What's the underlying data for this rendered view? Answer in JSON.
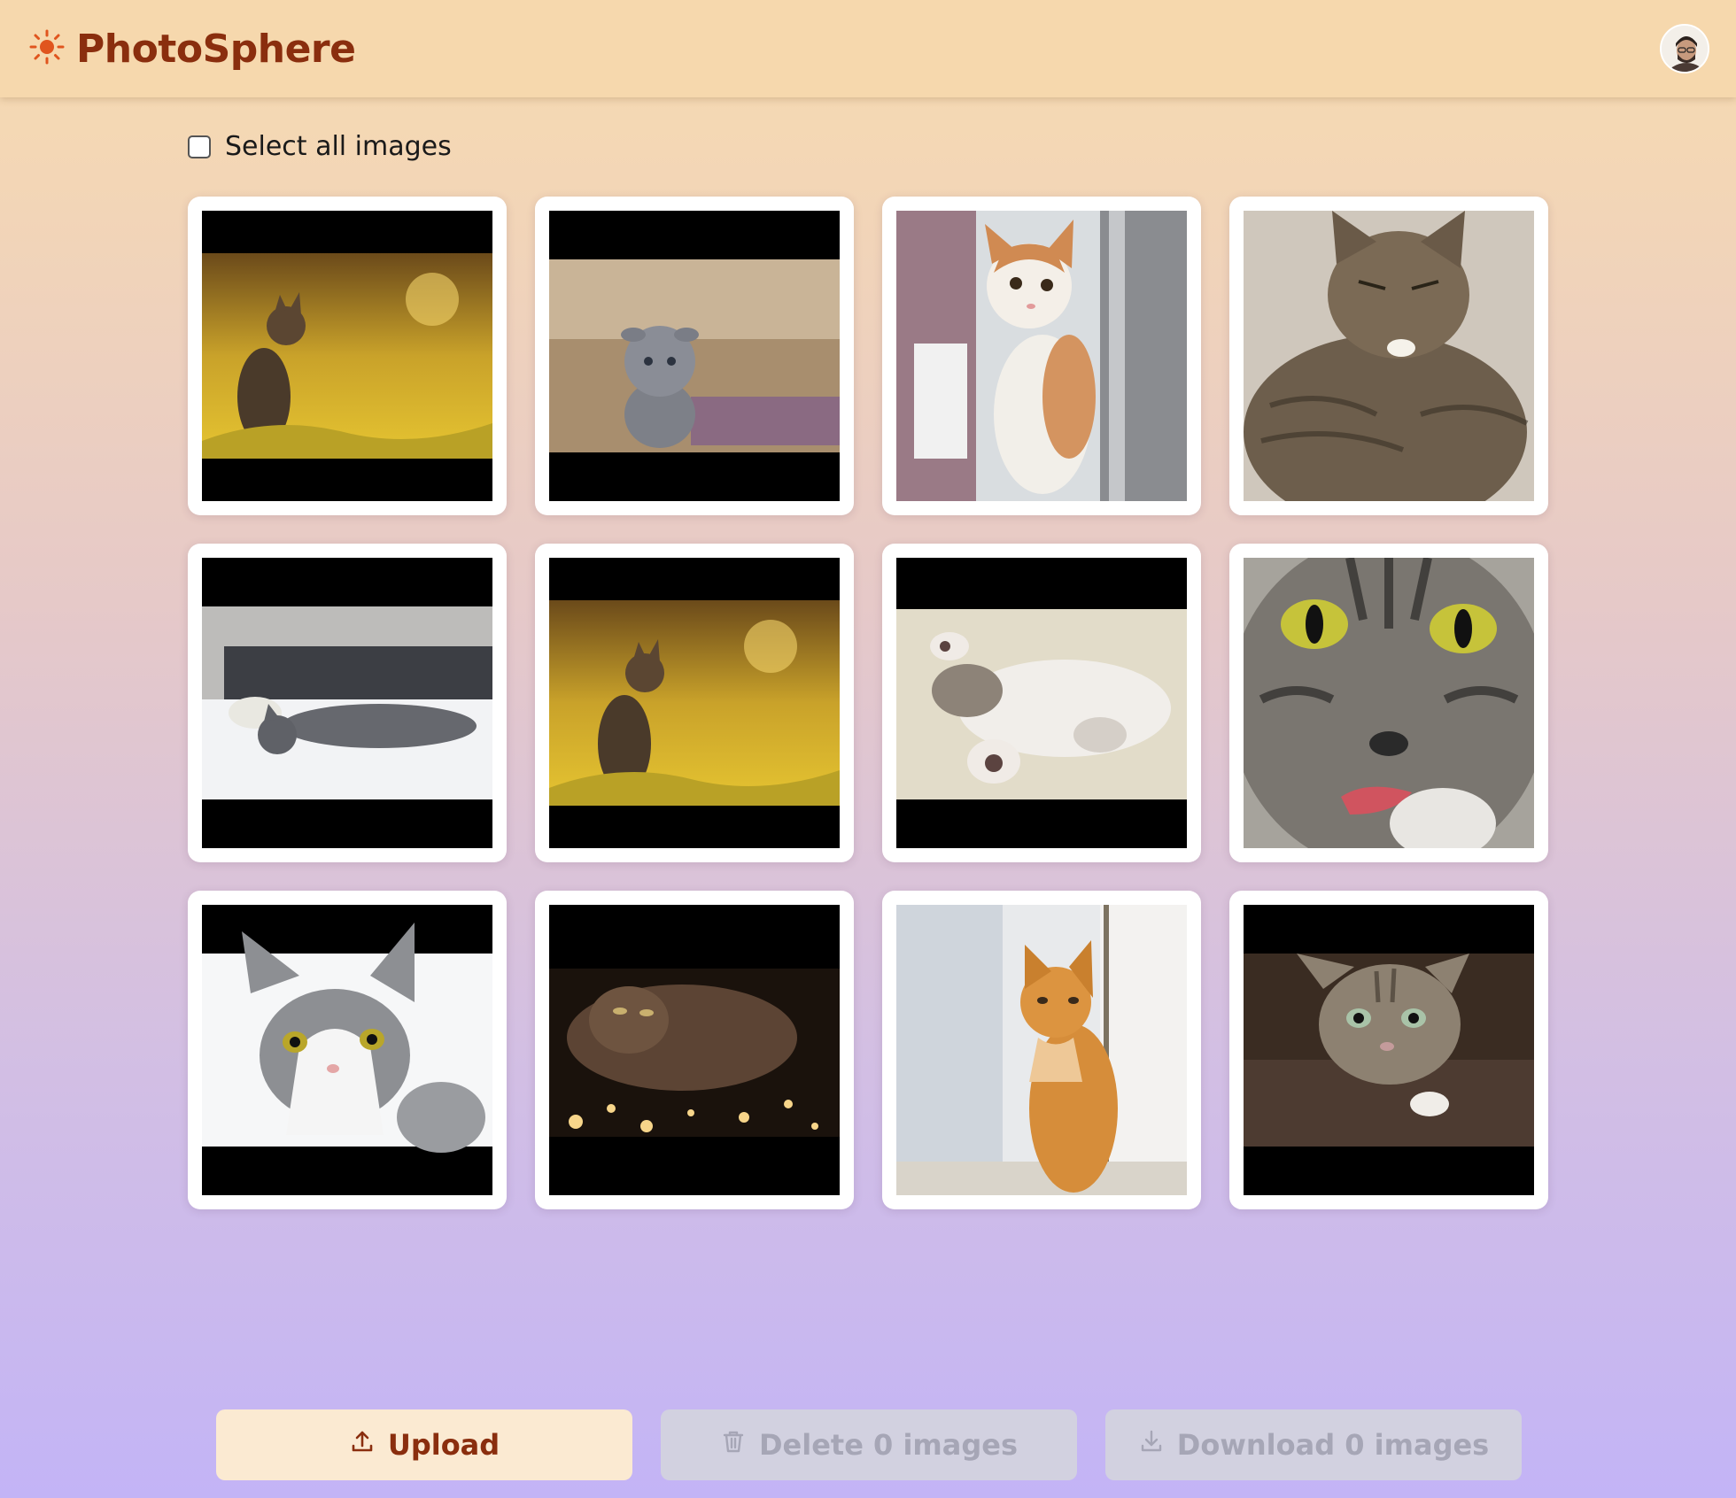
{
  "app": {
    "name": "PhotoSphere",
    "logo_icon": "sun-icon",
    "brand_color": "#8a2e0e"
  },
  "header": {
    "avatar_icon": "user-avatar"
  },
  "selection": {
    "select_all_label": "Select all images",
    "checked": false
  },
  "gallery": {
    "images": [
      {
        "subject": "tabby kitten in yellow flowers"
      },
      {
        "subject": "grey scottish fold kitten"
      },
      {
        "subject": "white and orange cat looking up"
      },
      {
        "subject": "tabby cat grumpy face"
      },
      {
        "subject": "grey cat lying on bed"
      },
      {
        "subject": "tabby kitten in yellow flowers"
      },
      {
        "subject": "kitten rolling on its back"
      },
      {
        "subject": "tabby cat close-up licking"
      },
      {
        "subject": "grey and white cat"
      },
      {
        "subject": "cat among fairy lights"
      },
      {
        "subject": "orange tabby cat by window"
      },
      {
        "subject": "tabby cat looking up"
      }
    ]
  },
  "actions": {
    "upload_label": "Upload",
    "delete_label": "Delete 0 images",
    "download_label": "Download 0 images",
    "upload_icon": "upload-icon",
    "delete_icon": "trash-icon",
    "download_icon": "download-icon",
    "accent": "#fbead2",
    "disabled": "#d2d1e0"
  }
}
